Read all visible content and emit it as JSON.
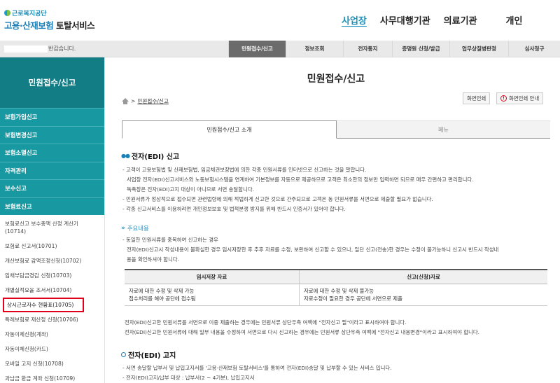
{
  "header": {
    "logo_org": "근로복지공단",
    "logo_main_a": "고용·산재보험",
    "logo_main_b": "토탈서비스",
    "nav": [
      "사업장",
      "사무대행기관",
      "의료기관",
      "개인"
    ]
  },
  "greeting": "반갑습니다.",
  "tabs": [
    "민원접수/신고",
    "정보조회",
    "전자통지",
    "증명원 신청/발급",
    "업무상질병판정",
    "심사청구"
  ],
  "sidebar": {
    "title": "민원접수/신고",
    "menu": [
      "보험가입신고",
      "보험변경신고",
      "보험소멸신고",
      "자격관리",
      "보수신고",
      "보험료신고"
    ],
    "sub": [
      "보험료신고 보수총액 산정 계산기 (10714)",
      "보험료 신고서(10701)",
      "개산보험료 감액조정신청(10702)",
      "임채부담금경감 신청(10703)",
      "개별실적요율 조서서(10704)",
      "상시근로자수 현황표(10705)",
      "특례보험료 재산정 신청(10706)",
      "자동이체신청(계좌)",
      "자동이체신청(카드)",
      "모바일 고지 신청(10708)",
      "과납금 환급 계좌 신청(10709)"
    ],
    "highlight_index": 5
  },
  "main": {
    "title": "민원접수/신고",
    "breadcrumb": "민원접수/신고",
    "print_btn": "화면인쇄",
    "guide_btn": "화면인쇄 안내",
    "content_tabs": [
      "민원접수/신고 소개",
      "메뉴"
    ],
    "section1": {
      "heading": "전자(EDI) 신고",
      "bullets": [
        "- 고객이 고용보험법 및 산재보험법, 임금채권보장법에 의한 각종 민원서류를 인터넷으로 신고하는 것을 말합니다.",
        "사업장 전자(EDI)신고서비스와 노동보험시스템을 연계하여 기본정보를 자동으로 제공하므로 고객은 최소한의 정보만 입력하면 되므로 매우 간편하고 편리합니다.",
        "독촉장은 전자(EDI)고지 대상이 아니므로 서면 송달합니다.",
        "- 민원서류가 정상적으로 접수되면 관련법령에 의해 적법하게 신고한 것으로 간주되므로 고객은 동 민원서류를 서면으로 제출할 필요가 없습니다.",
        "- 각종 신고서비스를 이용하려면 개인정보보호 및 법적분쟁 방지를 위해 반드시 인증서가 있어야 합니다."
      ],
      "sub_heading": "주요내용",
      "sub_bullets": [
        "- 동일한 민원서류를 중복하여 신고하는 경우",
        "전자(EDI)신고시 작성내용이 불확실한 경우 임시저장한 후 추후 자료를 수정, 보완하여 신고할 수 있으나, 일단 신고(전송)한 경우는 수정이 불가능하니 신고시 반드시 작성내",
        "용을 확인하셔야 합니다."
      ]
    },
    "table": {
      "headers": [
        "임시저장 자료",
        "신고(신청)자료"
      ],
      "col1": [
        "자료에 대한 수정 및 삭제 가능",
        "접수처리를 해야 공단에 접수됨"
      ],
      "col2": [
        "자료에 대한 수정 및 삭제 불가능",
        "자료수정이 필요한 경우 공단에 서면으로 제출"
      ]
    },
    "notes": [
      "전자(EDI)신고한 민원서류를 서면으로 이중 제출하는 경우에는 민원서류 상단우측 여백에 \"전자신고 필\"이라고 표시하여야 합니다.",
      "전자(EDI)신고한 민원서류에 대해 일부 내용을 수정하여 서면으로 다시 신고하는 경우에는 민원서류 상단우측 여백에 \"전자신고 내용변경\"이라고 표시하여야 합니다."
    ],
    "section2": {
      "heading": "전자(EDI) 고지",
      "bullets": [
        "- 서면 송달할 납부서 및 납입고지서를 '고용·산재보험 토탈서비스'를 통하여 전자(EDI)송달 및 납부할 수 있는 서비스 입니다.",
        "- 전자(EDI)고지/납부 대상 : 납부서(2 ~ 4기분), 납입고지서"
      ]
    }
  }
}
